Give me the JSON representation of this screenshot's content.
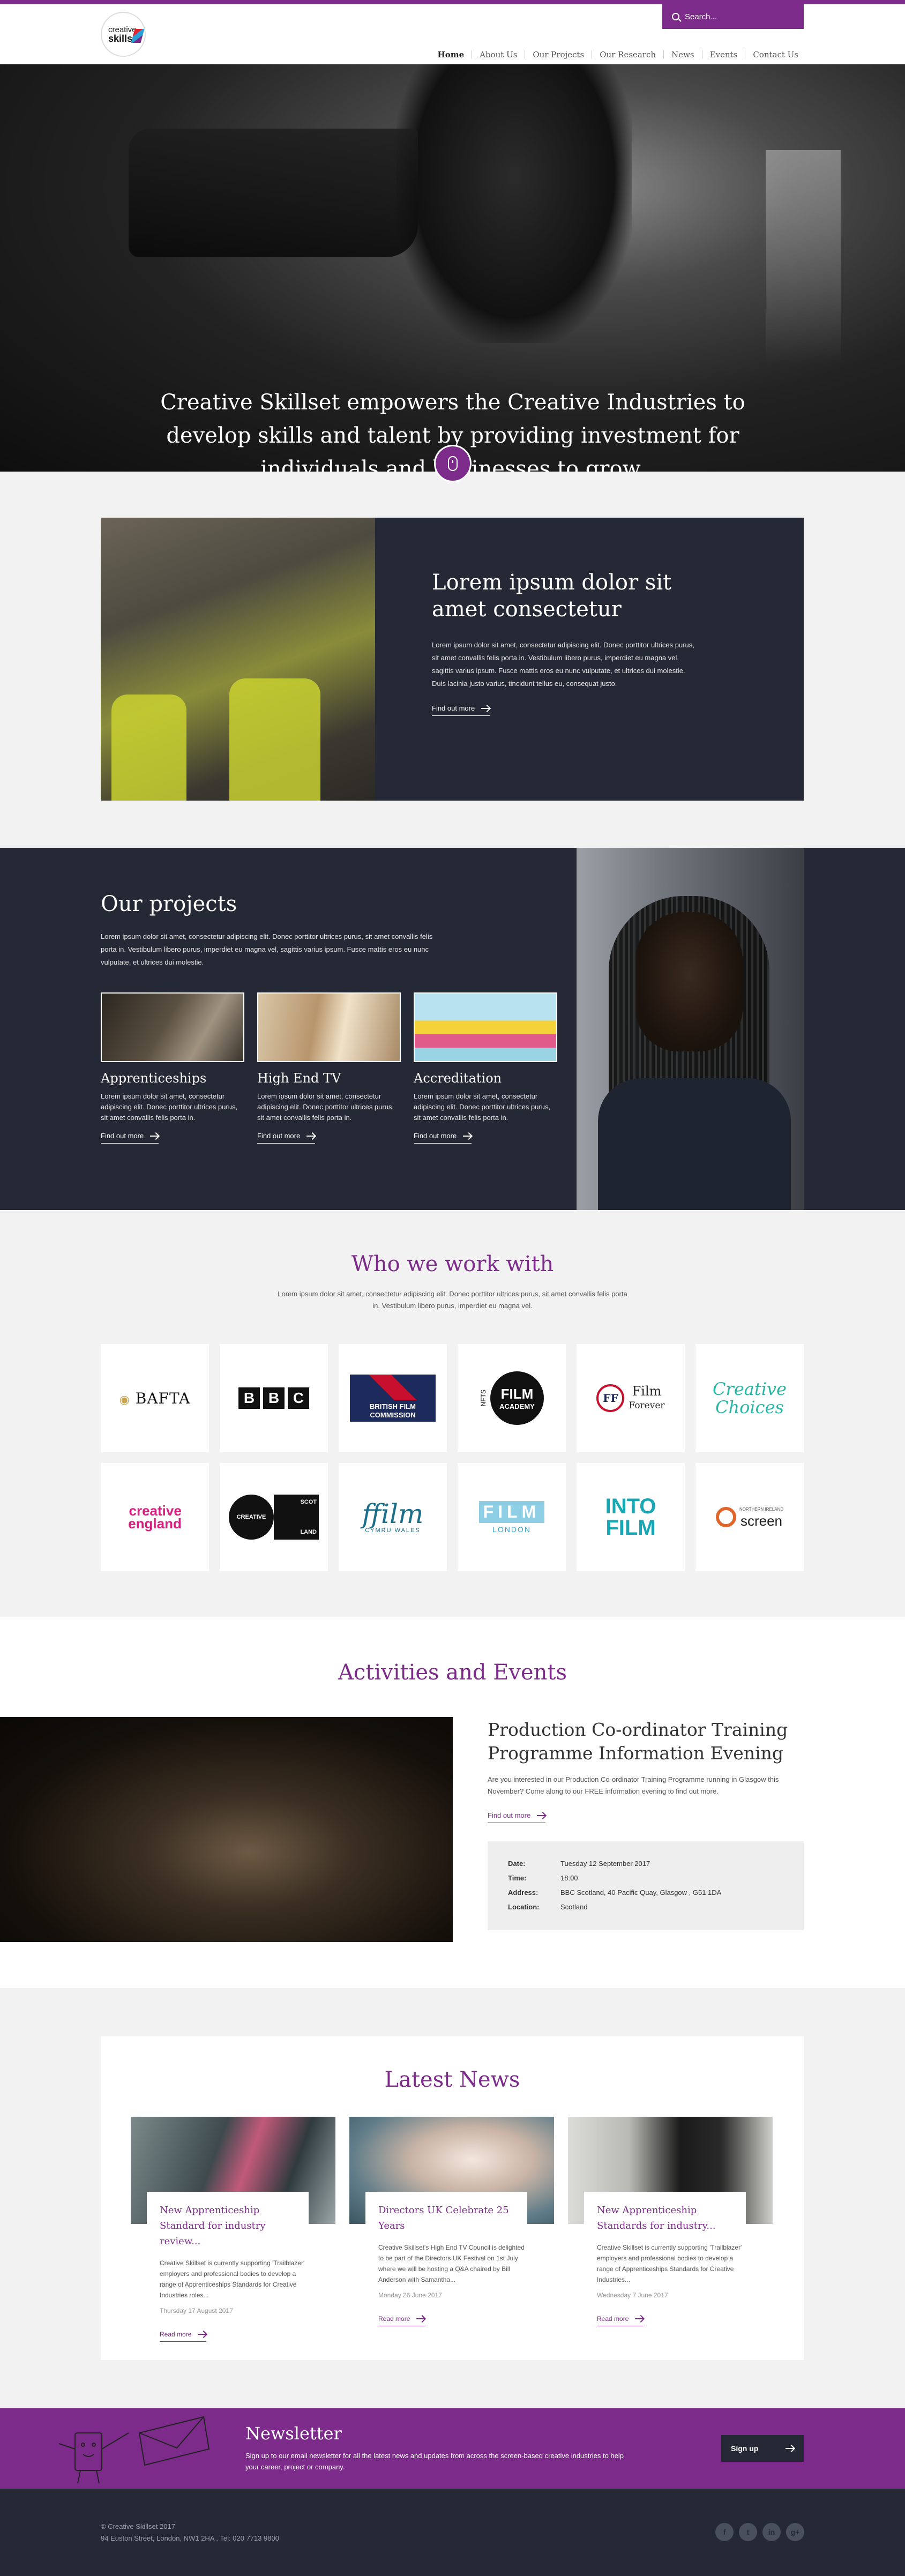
{
  "header": {
    "logo_line1": "creative",
    "logo_line2": "skillset",
    "search_placeholder": "Search...",
    "nav": [
      "Home",
      "About Us",
      "Our Projects",
      "Our Research",
      "News",
      "Events",
      "Contact Us"
    ]
  },
  "hero": {
    "headline": "Creative Skillset empowers the Creative Industries to develop skills and talent by providing investment for individuals and businesses to grow."
  },
  "feature": {
    "title": "Lorem ipsum dolor sit amet consectetur",
    "body": "Lorem ipsum dolor sit amet, consectetur adipiscing elit. Donec porttitor ultrices purus, sit amet convallis felis porta in. Vestibulum libero purus, imperdiet eu magna vel, sagittis varius ipsum. Fusce mattis eros eu nunc vulputate, et ultrices dui molestie. Duis lacinia justo varius, tincidunt tellus eu, consequat justo.",
    "link": "Find out more"
  },
  "projects": {
    "title": "Our projects",
    "intro": "Lorem ipsum dolor sit amet, consectetur adipiscing elit. Donec porttitor ultrices purus, sit amet convallis felis porta in. Vestibulum libero purus, imperdiet eu magna vel, sagittis varius ipsum. Fusce mattis eros eu nunc vulputate, et ultrices dui molestie.",
    "items": [
      {
        "title": "Apprenticeships",
        "text": "Lorem ipsum dolor sit amet, consectetur adipiscing elit. Donec porttitor ultrices purus, sit amet convallis felis porta in.",
        "link": "Find out more"
      },
      {
        "title": "High End TV",
        "text": "Lorem ipsum dolor sit amet, consectetur adipiscing elit. Donec porttitor ultrices purus, sit amet convallis felis porta in.",
        "link": "Find out more"
      },
      {
        "title": "Accreditation",
        "text": "Lorem ipsum dolor sit amet, consectetur adipiscing elit. Donec porttitor ultrices purus, sit amet convallis felis porta in.",
        "link": "Find out more"
      }
    ]
  },
  "partners": {
    "title": "Who we work with",
    "intro": "Lorem ipsum dolor sit amet, consectetur adipiscing elit. Donec porttitor ultrices purus, sit amet convallis felis porta in. Vestibulum libero purus, imperdiet eu magna vel.",
    "logos": {
      "bafta": "BAFTA",
      "bbc": [
        "B",
        "B",
        "C"
      ],
      "bfc_line1": "BRITISH FILM",
      "bfc_line2": "COMMISSION",
      "nfa_prefix": "NFTS",
      "nfa_line1": "FILM",
      "nfa_line2": "ACADEMY",
      "ff_badge": "FF",
      "ff_line1": "Film",
      "ff_line2": "Forever",
      "cc_line1": "Creative",
      "cc_line2": "Choices",
      "ce_line1": "creative",
      "ce_line2": "england",
      "cs_left": "CREATIVE",
      "cs_right_top": "SCOT",
      "cs_right_bottom": "LAND",
      "fcw_main": "ffilm",
      "fcw_sub": "CYMRU WALES",
      "fl_main": "FILM",
      "fl_sub": "LONDON",
      "if_line1": "INTO",
      "if_line2": "FILM",
      "ni_top": "NORTHERN IRELAND",
      "ni_main": "screen"
    }
  },
  "events": {
    "title": "Activities and Events",
    "event_title": "Production Co-ordinator Training Programme Information Evening",
    "event_text": "Are you interested in our Production Co-ordinator Training Programme running in Glasgow this November? Come along to our FREE information evening to find out more.",
    "link": "Find out more",
    "details": [
      {
        "label": "Date:",
        "value": "Tuesday 12 September 2017"
      },
      {
        "label": "Time:",
        "value": "18:00"
      },
      {
        "label": "Address:",
        "value": "BBC Scotland, 40 Pacific Quay, Glasgow , G51 1DA"
      },
      {
        "label": "Location:",
        "value": "Scotland"
      }
    ]
  },
  "news": {
    "title": "Latest News",
    "items": [
      {
        "title": "New Apprenticeship Standard for industry review...",
        "text": "Creative Skillset is currently supporting 'Trailblazer' employers and professional bodies to develop a range of Apprenticeships Standards for Creative Industries roles...",
        "date": "Thursday 17 August 2017",
        "link": "Read more"
      },
      {
        "title": "Directors UK Celebrate 25 Years",
        "text": "Creative Skillset's High End TV Council is delighted to be part of the Directors UK Festival on 1st July where we will be hosting a Q&A chaired by Bill Anderson with Samantha...",
        "date": "Monday 26 June 2017",
        "link": "Read more"
      },
      {
        "title": "New Apprenticeship Standards for industry...",
        "text": "Creative Skillset is currently supporting 'Trailblazer' employers and professional bodies to develop a range of Apprenticeships Standards for Creative Industries...",
        "date": "Wednesday 7 June 2017",
        "link": "Read more"
      }
    ]
  },
  "newsletter": {
    "title": "Newsletter",
    "text": "Sign up to our email newsletter for all the latest news and updates from across  the screen-based creative industries to help your career, project or company.",
    "button": "Sign up"
  },
  "footer": {
    "copyright": "© Creative Skillset 2017",
    "address": "94 Euston Street, London, NW1 2HA . Tel: 020 7713 9800",
    "social": [
      "f",
      "t",
      "in",
      "g+"
    ]
  },
  "colors": {
    "brand": "#7d2b8b",
    "dark": "#252935"
  }
}
